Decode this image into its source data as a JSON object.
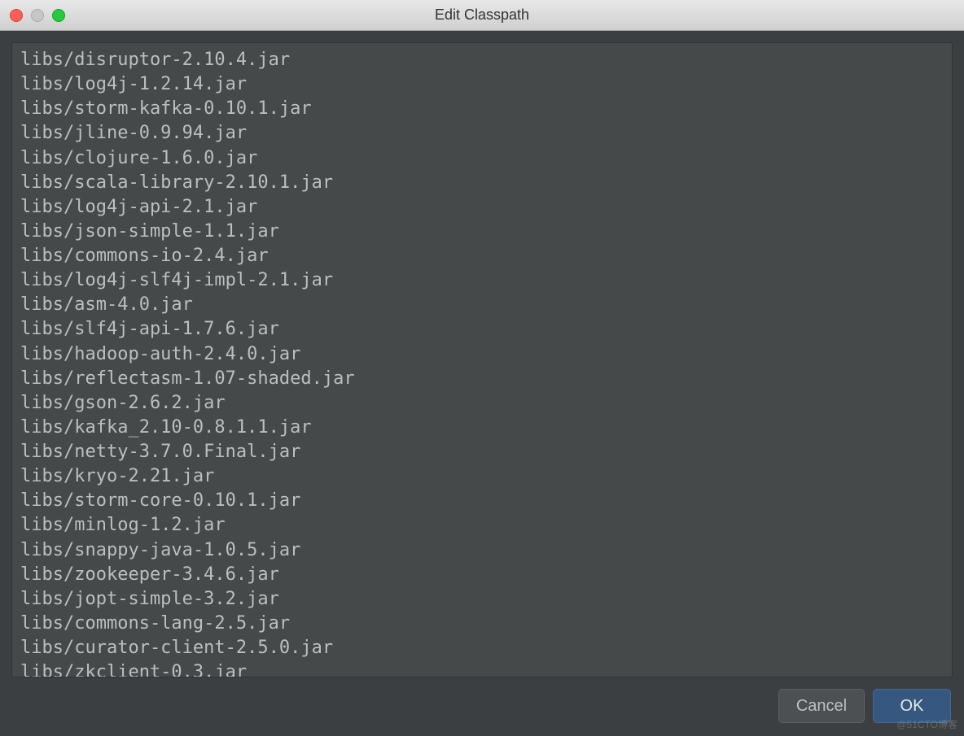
{
  "window": {
    "title": "Edit Classpath"
  },
  "classpath": {
    "items": [
      "libs/disruptor-2.10.4.jar",
      "libs/log4j-1.2.14.jar",
      "libs/storm-kafka-0.10.1.jar",
      "libs/jline-0.9.94.jar",
      "libs/clojure-1.6.0.jar",
      "libs/scala-library-2.10.1.jar",
      "libs/log4j-api-2.1.jar",
      "libs/json-simple-1.1.jar",
      "libs/commons-io-2.4.jar",
      "libs/log4j-slf4j-impl-2.1.jar",
      "libs/asm-4.0.jar",
      "libs/slf4j-api-1.7.6.jar",
      "libs/hadoop-auth-2.4.0.jar",
      "libs/reflectasm-1.07-shaded.jar",
      "libs/gson-2.6.2.jar",
      "libs/kafka_2.10-0.8.1.1.jar",
      "libs/netty-3.7.0.Final.jar",
      "libs/kryo-2.21.jar",
      "libs/storm-core-0.10.1.jar",
      "libs/minlog-1.2.jar",
      "libs/snappy-java-1.0.5.jar",
      "libs/zookeeper-3.4.6.jar",
      "libs/jopt-simple-3.2.jar",
      "libs/commons-lang-2.5.jar",
      "libs/curator-client-2.5.0.jar",
      "libs/zkclient-0.3.jar"
    ]
  },
  "buttons": {
    "cancel": "Cancel",
    "ok": "OK"
  },
  "watermark": "@51CTO博客"
}
